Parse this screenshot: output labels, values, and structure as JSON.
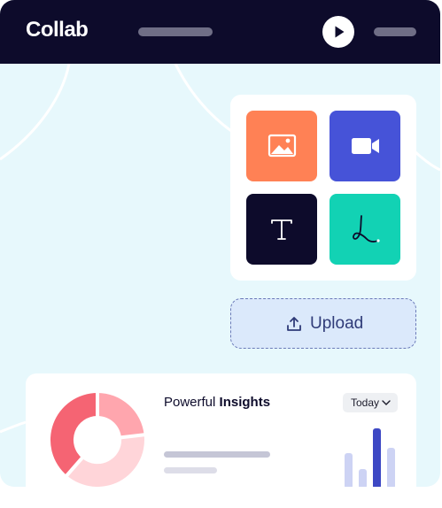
{
  "header": {
    "brand": "Collab",
    "icons": [
      "play-icon"
    ]
  },
  "colors": {
    "header_bg": "#0d0b2b",
    "page_bg": "#e7f8fc",
    "tile_image": "#ff8155",
    "tile_video": "#4653d8",
    "tile_text": "#0d0b2b",
    "tile_draw": "#12d2b4",
    "donut": [
      "#f56473",
      "#ffa6ae",
      "#ffd5d9"
    ],
    "bar_accent": "#3d48c4",
    "bar_muted": "#cdd3f4"
  },
  "tools": [
    {
      "name": "image",
      "icon": "image-icon"
    },
    {
      "name": "video",
      "icon": "video-camera-icon"
    },
    {
      "name": "text",
      "icon": "text-icon"
    },
    {
      "name": "draw",
      "icon": "pen-draw-icon"
    }
  ],
  "upload": {
    "label": "Upload",
    "icon": "upload-icon"
  },
  "insights": {
    "title_regular": "Powerful",
    "title_bold": "Insights",
    "period": "Today",
    "period_icon": "chevron-down-icon",
    "donut_icon": "donut-chart-icon",
    "bar_icon": "bar-chart-icon"
  }
}
